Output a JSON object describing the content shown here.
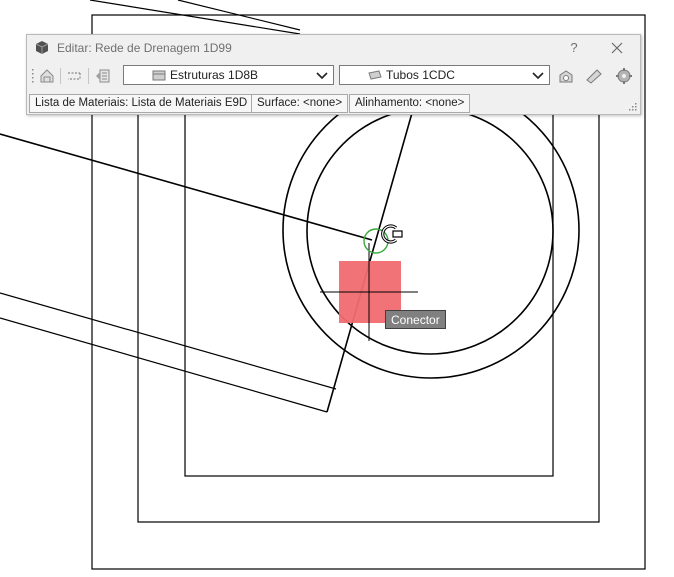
{
  "window": {
    "title": "Editar: Rede de Drenagem 1D99",
    "help_label": "?"
  },
  "toolbar": {
    "structures_combo": {
      "value": "Estruturas 1D8B"
    },
    "pipes_combo": {
      "value": "Tubos 1CDC"
    }
  },
  "properties": {
    "parts_list": "Lista de Materiais: Lista de Materiais E9D",
    "surface": "Surface: <none>",
    "alignment": "Alinhamento: <none>"
  },
  "drawing": {
    "tooltip": "Conector",
    "colors": {
      "linework": "#000000",
      "highlight_fill": "#f06b70",
      "snap_marker": "#3aa83a",
      "tooltip_bg": "#808080"
    }
  }
}
